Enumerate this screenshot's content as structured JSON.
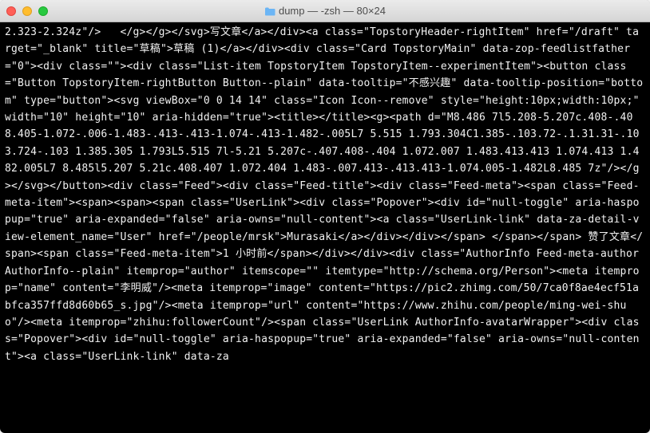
{
  "window": {
    "title": "dump — -zsh — 80×24"
  },
  "terminal": {
    "content": "2.323-2.324z\"/>   </g></g></svg>写文章</a></div><a class=\"TopstoryHeader-rightItem\" href=\"/draft\" target=\"_blank\" title=\"草稿\">草稿 (1)</a></div><div class=\"Card TopstoryMain\" data-zop-feedlistfather=\"0\"><div class=\"\"><div class=\"List-item TopstoryItem TopstoryItem--experimentItem\"><button class=\"Button TopstoryItem-rightButton Button--plain\" data-tooltip=\"不感兴趣\" data-tooltip-position=\"bottom\" type=\"button\"><svg viewBox=\"0 0 14 14\" class=\"Icon Icon--remove\" style=\"height:10px;width:10px;\" width=\"10\" height=\"10\" aria-hidden=\"true\"><title></title><g><path d=\"M8.486 7l5.208-5.207c.408-.408.405-1.072-.006-1.483-.413-.413-1.074-.413-1.482-.005L7 5.515 1.793.304C1.385-.103.72-.1.31.31-.103.724-.103 1.385.305 1.793L5.515 7l-5.21 5.207c-.407.408-.404 1.072.007 1.483.413.413 1.074.413 1.482.005L7 8.485l5.207 5.21c.408.407 1.072.404 1.483-.007.413-.413.413-1.074.005-1.482L8.485 7z\"/></g></svg></button><div class=\"Feed\"><div class=\"Feed-title\"><div class=\"Feed-meta\"><span class=\"Feed-meta-item\"><span><span><span class=\"UserLink\"><div class=\"Popover\"><div id=\"null-toggle\" aria-haspopup=\"true\" aria-expanded=\"false\" aria-owns=\"null-content\"><a class=\"UserLink-link\" data-za-detail-view-element_name=\"User\" href=\"/people/mrsk\">Murasaki</a></div></div></span> </span></span> 赞了文章</span><span class=\"Feed-meta-item\">1 小时前</span></div></div><div class=\"AuthorInfo Feed-meta-author AuthorInfo--plain\" itemprop=\"author\" itemscope=\"\" itemtype=\"http://schema.org/Person\"><meta itemprop=\"name\" content=\"李明威\"/><meta itemprop=\"image\" content=\"https://pic2.zhimg.com/50/7ca0f8ae4ecf51abfca357ffd8d60b65_s.jpg\"/><meta itemprop=\"url\" content=\"https://www.zhihu.com/people/ming-wei-shuo\"/><meta itemprop=\"zhihu:followerCount\"/><span class=\"UserLink AuthorInfo-avatarWrapper\"><div class=\"Popover\"><div id=\"null-toggle\" aria-haspopup=\"true\" aria-expanded=\"false\" aria-owns=\"null-content\"><a class=\"UserLink-link\" data-za"
  }
}
